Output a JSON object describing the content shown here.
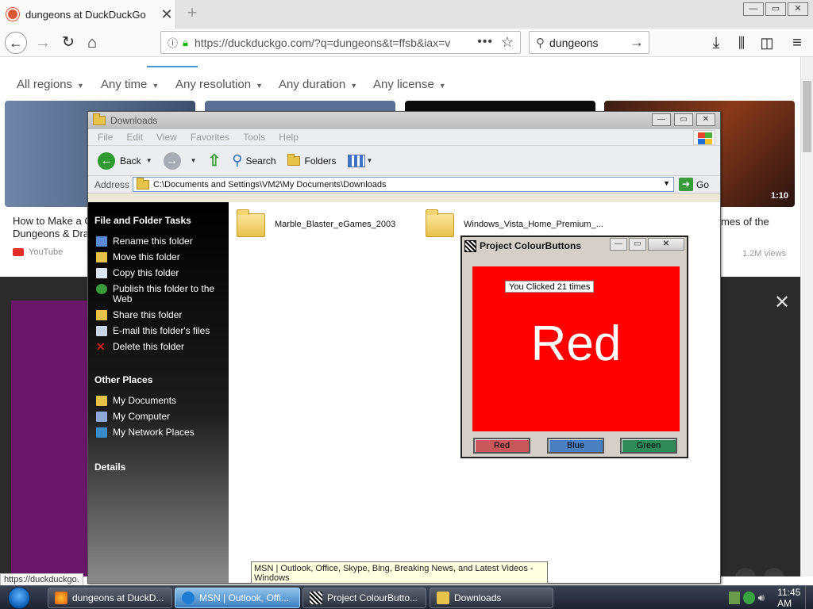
{
  "browser": {
    "tab_title": "dungeons at DuckDuckGo",
    "url": "https://duckduckgo.com/?q=dungeons&t=ffsb&iax=v",
    "search_query": "dungeons",
    "status_url": "https://duckduckgo.",
    "window_controls": [
      "—",
      "▭",
      "✕"
    ]
  },
  "ddg": {
    "filters": [
      "All regions",
      "Any time",
      "Any resolution",
      "Any duration",
      "Any license"
    ],
    "videos": [
      {
        "title_line1": "How to Make a C",
        "title_line2": "Dungeons & Dra",
        "source": "YouTube"
      },
      {
        "title_line1": "",
        "title_line2": "",
        "source": ""
      },
      {
        "title_line1": "",
        "title_line2": "",
        "source": ""
      },
      {
        "title_line1": "mes of the",
        "title_line2": "",
        "source": "",
        "duration": "1:10",
        "views": "1.2M views"
      }
    ]
  },
  "explorer": {
    "title": "Downloads",
    "menu": [
      "File",
      "Edit",
      "View",
      "Favorites",
      "Tools",
      "Help"
    ],
    "toolbar": {
      "back": "Back",
      "search": "Search",
      "folders": "Folders"
    },
    "address_label": "Address",
    "address_path": "C:\\Documents and Settings\\VM2\\My Documents\\Downloads",
    "go_label": "Go",
    "tasks_heading": "File and Folder Tasks",
    "tasks": [
      {
        "label": "Rename this folder",
        "icon": "rename-icon"
      },
      {
        "label": "Move this folder",
        "icon": "move-icon"
      },
      {
        "label": "Copy this folder",
        "icon": "copy-icon"
      },
      {
        "label": "Publish this folder to the Web",
        "icon": "globe-icon"
      },
      {
        "label": "Share this folder",
        "icon": "share-icon"
      },
      {
        "label": "E-mail this folder's files",
        "icon": "email-icon"
      },
      {
        "label": "Delete this folder",
        "icon": "delete-icon"
      }
    ],
    "other_heading": "Other Places",
    "other_places": [
      {
        "label": "My Documents",
        "icon": "folder-icon"
      },
      {
        "label": "My Computer",
        "icon": "computer-icon"
      },
      {
        "label": "My Network Places",
        "icon": "network-icon"
      }
    ],
    "details_heading": "Details",
    "files": [
      {
        "name": "Marble_Blaster_eGames_2003"
      },
      {
        "name": "Windows_Vista_Home_Premium_..."
      }
    ]
  },
  "vbapp": {
    "title": "Project ColourButtons",
    "counter_text": "You Clicked 21 times",
    "big_text": "Red",
    "canvas_color": "#ff0000",
    "buttons": [
      {
        "label": "Red",
        "color": "#c8585c"
      },
      {
        "label": "Blue",
        "color": "#4a7fc0"
      },
      {
        "label": "Green",
        "color": "#2f8a5a"
      }
    ]
  },
  "tooltip": "MSN | Outlook, Office, Skype, Bing, Breaking News, and Latest Videos - Windows",
  "taskbar": {
    "tasks": [
      {
        "label": "dungeons at DuckD..."
      },
      {
        "label": "MSN | Outlook, Offi..."
      },
      {
        "label": "Project ColourButto..."
      },
      {
        "label": "Downloads"
      }
    ],
    "clock": "11:45 AM"
  }
}
